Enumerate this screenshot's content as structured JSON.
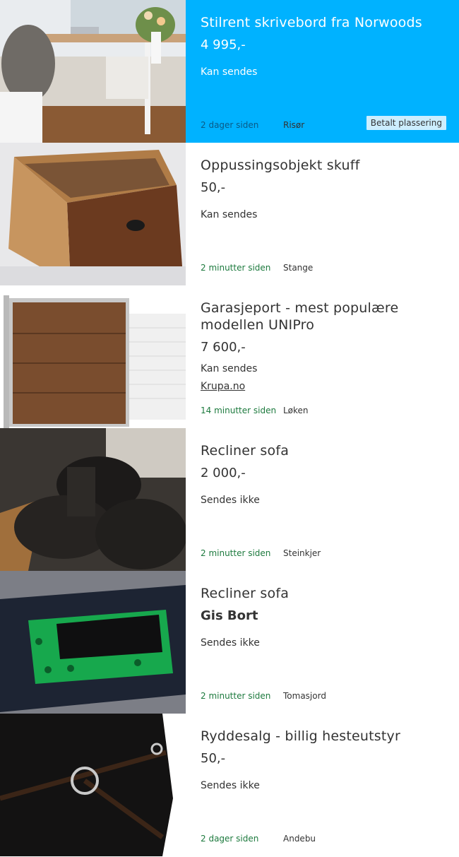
{
  "items": [
    {
      "title": "Stilrent skrivebord fra Norwoods",
      "price": "4 995,-",
      "shipping": "Kan sendes",
      "time": "2 dager siden",
      "location": "Risør",
      "badge": "Betalt plassering",
      "image": "desk-photo"
    },
    {
      "title": "Oppussingsobjekt skuff",
      "price": "50,-",
      "shipping": "Kan sendes",
      "time": "2 minutter siden",
      "location": "Stange",
      "image": "drawer-photo"
    },
    {
      "title": "Garasjeport - mest populære modellen UNIPro",
      "price": "7 600,-",
      "shipping": "Kan sendes",
      "link": "Krupa.no",
      "time": "14 minutter siden",
      "location": "Løken",
      "image": "garage-door-photo"
    },
    {
      "title": "Recliner sofa",
      "price": "2 000,-",
      "shipping": "Sendes ikke",
      "time": "2 minutter siden",
      "location": "Steinkjer",
      "image": "sofa-photo"
    },
    {
      "title": "Recliner sofa",
      "price": "Gis Bort",
      "shipping": "Sendes ikke",
      "time": "2 minutter siden",
      "location": "Tomasjord",
      "image": "circuit-board-photo"
    },
    {
      "title": "Ryddesalg - billig hesteutstyr",
      "price": "50,-",
      "shipping": "Sendes ikke",
      "time": "2 dager siden",
      "location": "Andebu",
      "image": "horse-bridle-photo"
    }
  ]
}
